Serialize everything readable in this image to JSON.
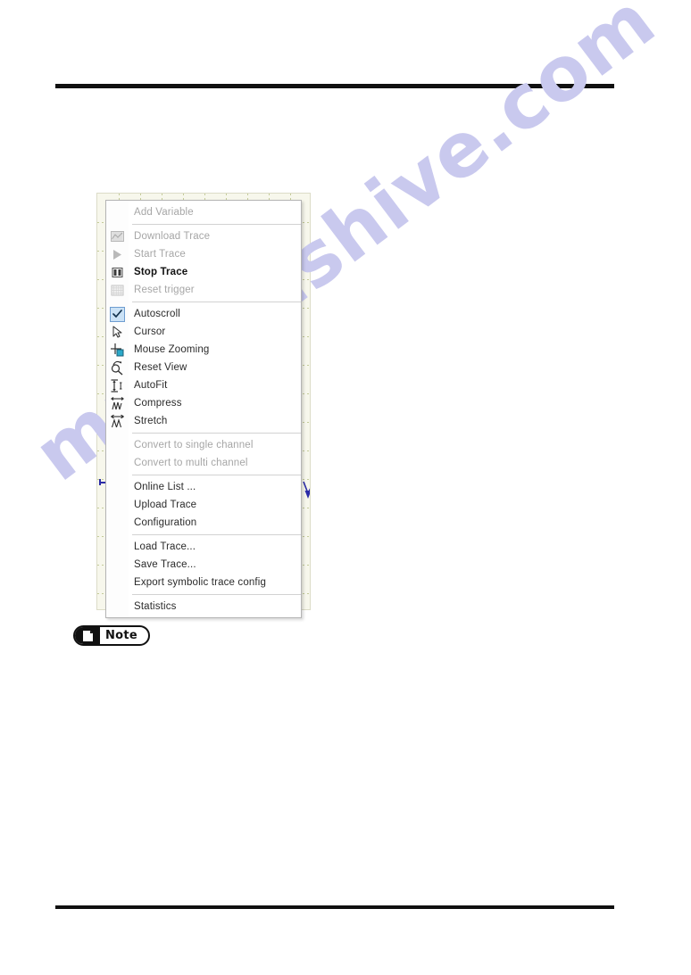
{
  "page": {
    "watermark_text": "manualshive.com",
    "watermark_color": "#c9c9ee",
    "background_color": "#ffffff",
    "rule_color": "#101010"
  },
  "plot": {
    "background_color": "#f7f7ec",
    "gridline_color": "#c4cb9a",
    "marker_color": "#2b2ba8",
    "left_axis_marker_name": "trigger-marker",
    "cursor_marker_name": "cursor-marker"
  },
  "context_menu": {
    "title": "Trace context menu",
    "groups": [
      {
        "items": [
          {
            "label": "Add Variable",
            "icon": "none",
            "state": "disabled"
          }
        ]
      },
      {
        "items": [
          {
            "label": "Download Trace",
            "icon": "download-trace-icon",
            "state": "disabled"
          },
          {
            "label": "Start Trace",
            "icon": "start-trace-icon",
            "state": "disabled"
          },
          {
            "label": "Stop Trace",
            "icon": "stop-trace-icon",
            "state": "enabled-bold"
          },
          {
            "label": "Reset trigger",
            "icon": "reset-trigger-icon",
            "state": "disabled"
          }
        ]
      },
      {
        "items": [
          {
            "label": "Autoscroll",
            "icon": "checkbox-checked-icon",
            "state": "enabled",
            "checked": true
          },
          {
            "label": "Cursor",
            "icon": "cursor-arrow-icon",
            "state": "enabled"
          },
          {
            "label": "Mouse Zooming",
            "icon": "mouse-zoom-icon",
            "state": "enabled"
          },
          {
            "label": "Reset View",
            "icon": "reset-view-icon",
            "state": "enabled"
          },
          {
            "label": "AutoFit",
            "icon": "autofit-icon",
            "state": "enabled"
          },
          {
            "label": "Compress",
            "icon": "compress-icon",
            "state": "enabled"
          },
          {
            "label": "Stretch",
            "icon": "stretch-icon",
            "state": "enabled"
          }
        ]
      },
      {
        "items": [
          {
            "label": "Convert to single channel",
            "icon": "none",
            "state": "disabled"
          },
          {
            "label": "Convert to multi channel",
            "icon": "none",
            "state": "disabled"
          }
        ]
      },
      {
        "items": [
          {
            "label": "Online List ...",
            "icon": "none",
            "state": "enabled"
          },
          {
            "label": "Upload Trace",
            "icon": "none",
            "state": "enabled"
          },
          {
            "label": "Configuration",
            "icon": "none",
            "state": "enabled"
          }
        ]
      },
      {
        "items": [
          {
            "label": "Load Trace...",
            "icon": "none",
            "state": "enabled"
          },
          {
            "label": "Save Trace...",
            "icon": "none",
            "state": "enabled"
          },
          {
            "label": "Export symbolic trace config",
            "icon": "none",
            "state": "enabled"
          }
        ]
      },
      {
        "items": [
          {
            "label": "Statistics",
            "icon": "none",
            "state": "enabled"
          }
        ]
      }
    ]
  },
  "note_badge": {
    "label": "Note",
    "icon": "note-document-icon"
  }
}
